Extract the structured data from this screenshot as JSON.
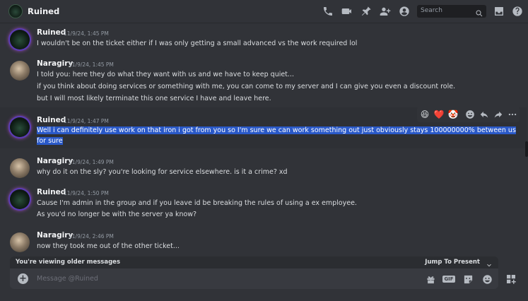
{
  "header": {
    "title": "Ruined",
    "search_placeholder": "Search",
    "icons": [
      "phone-icon",
      "video-icon",
      "pin-icon",
      "add-member-icon",
      "profile-icon",
      "search-icon",
      "inbox-icon",
      "help-icon"
    ]
  },
  "messages": [
    {
      "author": "Ruined",
      "time": "11/9/24, 1:45 PM",
      "lines": [
        "I wouldn't be on the ticket either if I was only getting a small advanced vs the work required lol"
      ]
    },
    {
      "author": "Naragiry",
      "time": "11/9/24, 1:45 PM",
      "lines": [
        "I told you: here they do what they want with us and we have to keep quiet...",
        "if you think about doing services or something with me, you can come to my server and I can give you even a discount role.",
        "but I will most likely terminate this one service I have and leave here."
      ]
    },
    {
      "author": "Ruined",
      "time": "11/9/24, 1:47 PM",
      "lines": [
        "Well i can definitely use work on that iron i got from you so I'm sure we can work something out just obviously stays 100000000% between us",
        "for sure"
      ]
    },
    {
      "author": "Naragiry",
      "time": "11/9/24, 1:49 PM",
      "lines": [
        "why do it on the sly? you're looking for service elsewhere. is it a crime? xd"
      ]
    },
    {
      "author": "Ruined",
      "time": "11/9/24, 1:50 PM",
      "lines": [
        "Cause I'm admin in the group and if you leave id be breaking the rules of using a ex employee.",
        "As you'd no longer be with the server ya know?"
      ]
    },
    {
      "author": "Naragiry",
      "time": "11/9/24, 2:46 PM",
      "lines": [
        "now they took me out of the other ticket..."
      ]
    }
  ],
  "reactions": [
    "😆",
    "❤️",
    "🤡"
  ],
  "older_bar": {
    "label": "You're viewing older messages",
    "jump_label": "Jump To Present"
  },
  "composer": {
    "placeholder": "Message @Ruined",
    "gif_label": "GIF"
  }
}
